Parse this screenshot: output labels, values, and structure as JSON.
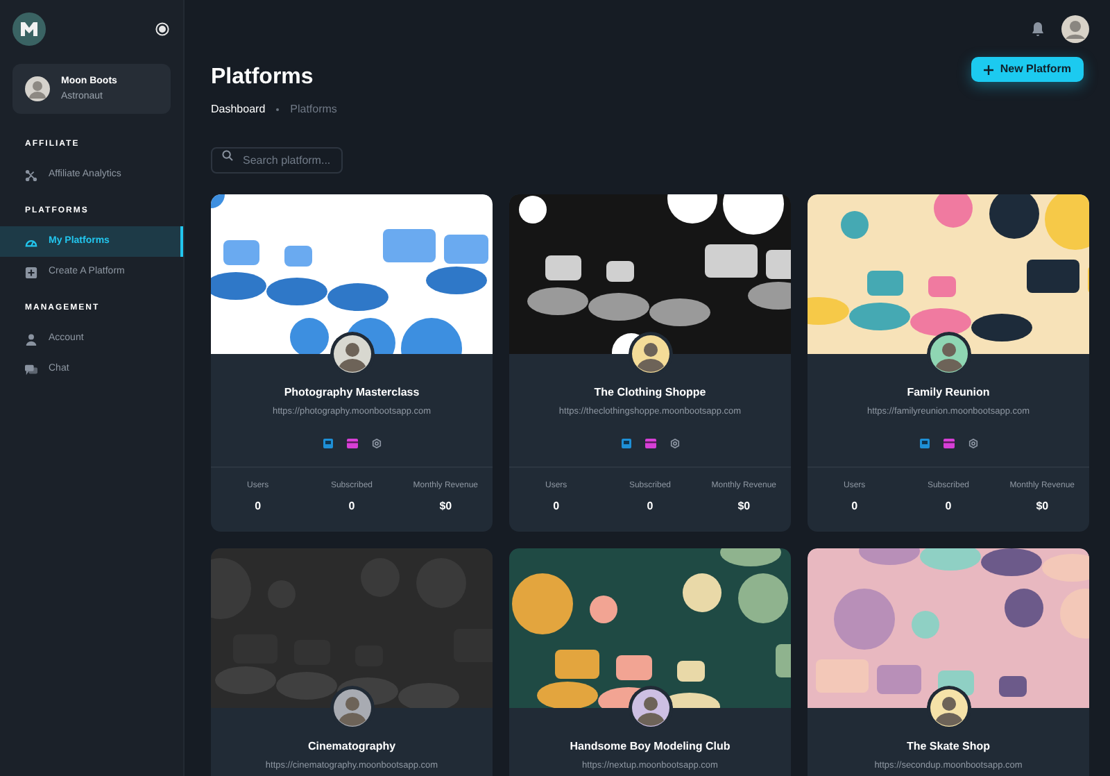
{
  "sidebar": {
    "profile": {
      "name": "Moon Boots",
      "role": "Astronaut"
    },
    "sections": [
      {
        "title": "AFFILIATE",
        "items": [
          {
            "label": "Affiliate Analytics",
            "kind": "analytics",
            "selected": false
          }
        ]
      },
      {
        "title": "PLATFORMS",
        "items": [
          {
            "label": "My Platforms",
            "kind": "gauge",
            "selected": true
          },
          {
            "label": "Create A Platform",
            "kind": "add",
            "selected": false
          }
        ]
      },
      {
        "title": "MANAGEMENT",
        "items": [
          {
            "label": "Account",
            "kind": "person",
            "selected": false
          },
          {
            "label": "Chat",
            "kind": "chat",
            "selected": false
          }
        ]
      }
    ]
  },
  "page": {
    "title": "Platforms",
    "breadcrumb": [
      "Dashboard",
      "Platforms"
    ],
    "new_button": "New Platform",
    "search": {
      "placeholder": "Search platform..."
    }
  },
  "platforms": [
    {
      "name": "Photography Masterclass",
      "url": "https://photography.moonbootsapp.com",
      "stats": [
        {
          "label": "Users",
          "value": "0"
        },
        {
          "label": "Subscribed",
          "value": "0"
        },
        {
          "label": "Monthly Revenue",
          "value": "$0"
        }
      ]
    },
    {
      "name": "The Clothing Shoppe",
      "url": "https://theclothingshoppe.moonbootsapp.com",
      "stats": [
        {
          "label": "Users",
          "value": "0"
        },
        {
          "label": "Subscribed",
          "value": "0"
        },
        {
          "label": "Monthly Revenue",
          "value": "$0"
        }
      ]
    },
    {
      "name": "Family Reunion",
      "url": "https://familyreunion.moonbootsapp.com",
      "stats": [
        {
          "label": "Users",
          "value": "0"
        },
        {
          "label": "Subscribed",
          "value": "0"
        },
        {
          "label": "Monthly Revenue",
          "value": "$0"
        }
      ]
    },
    {
      "name": "Cinematography",
      "url": "https://cinematography.moonbootsapp.com"
    },
    {
      "name": "Handsome Boy Modeling Club",
      "url": "https://nextup.moonbootsapp.com"
    },
    {
      "name": "The Skate Shop",
      "url": "https://secondup.moonbootsapp.com"
    }
  ]
}
